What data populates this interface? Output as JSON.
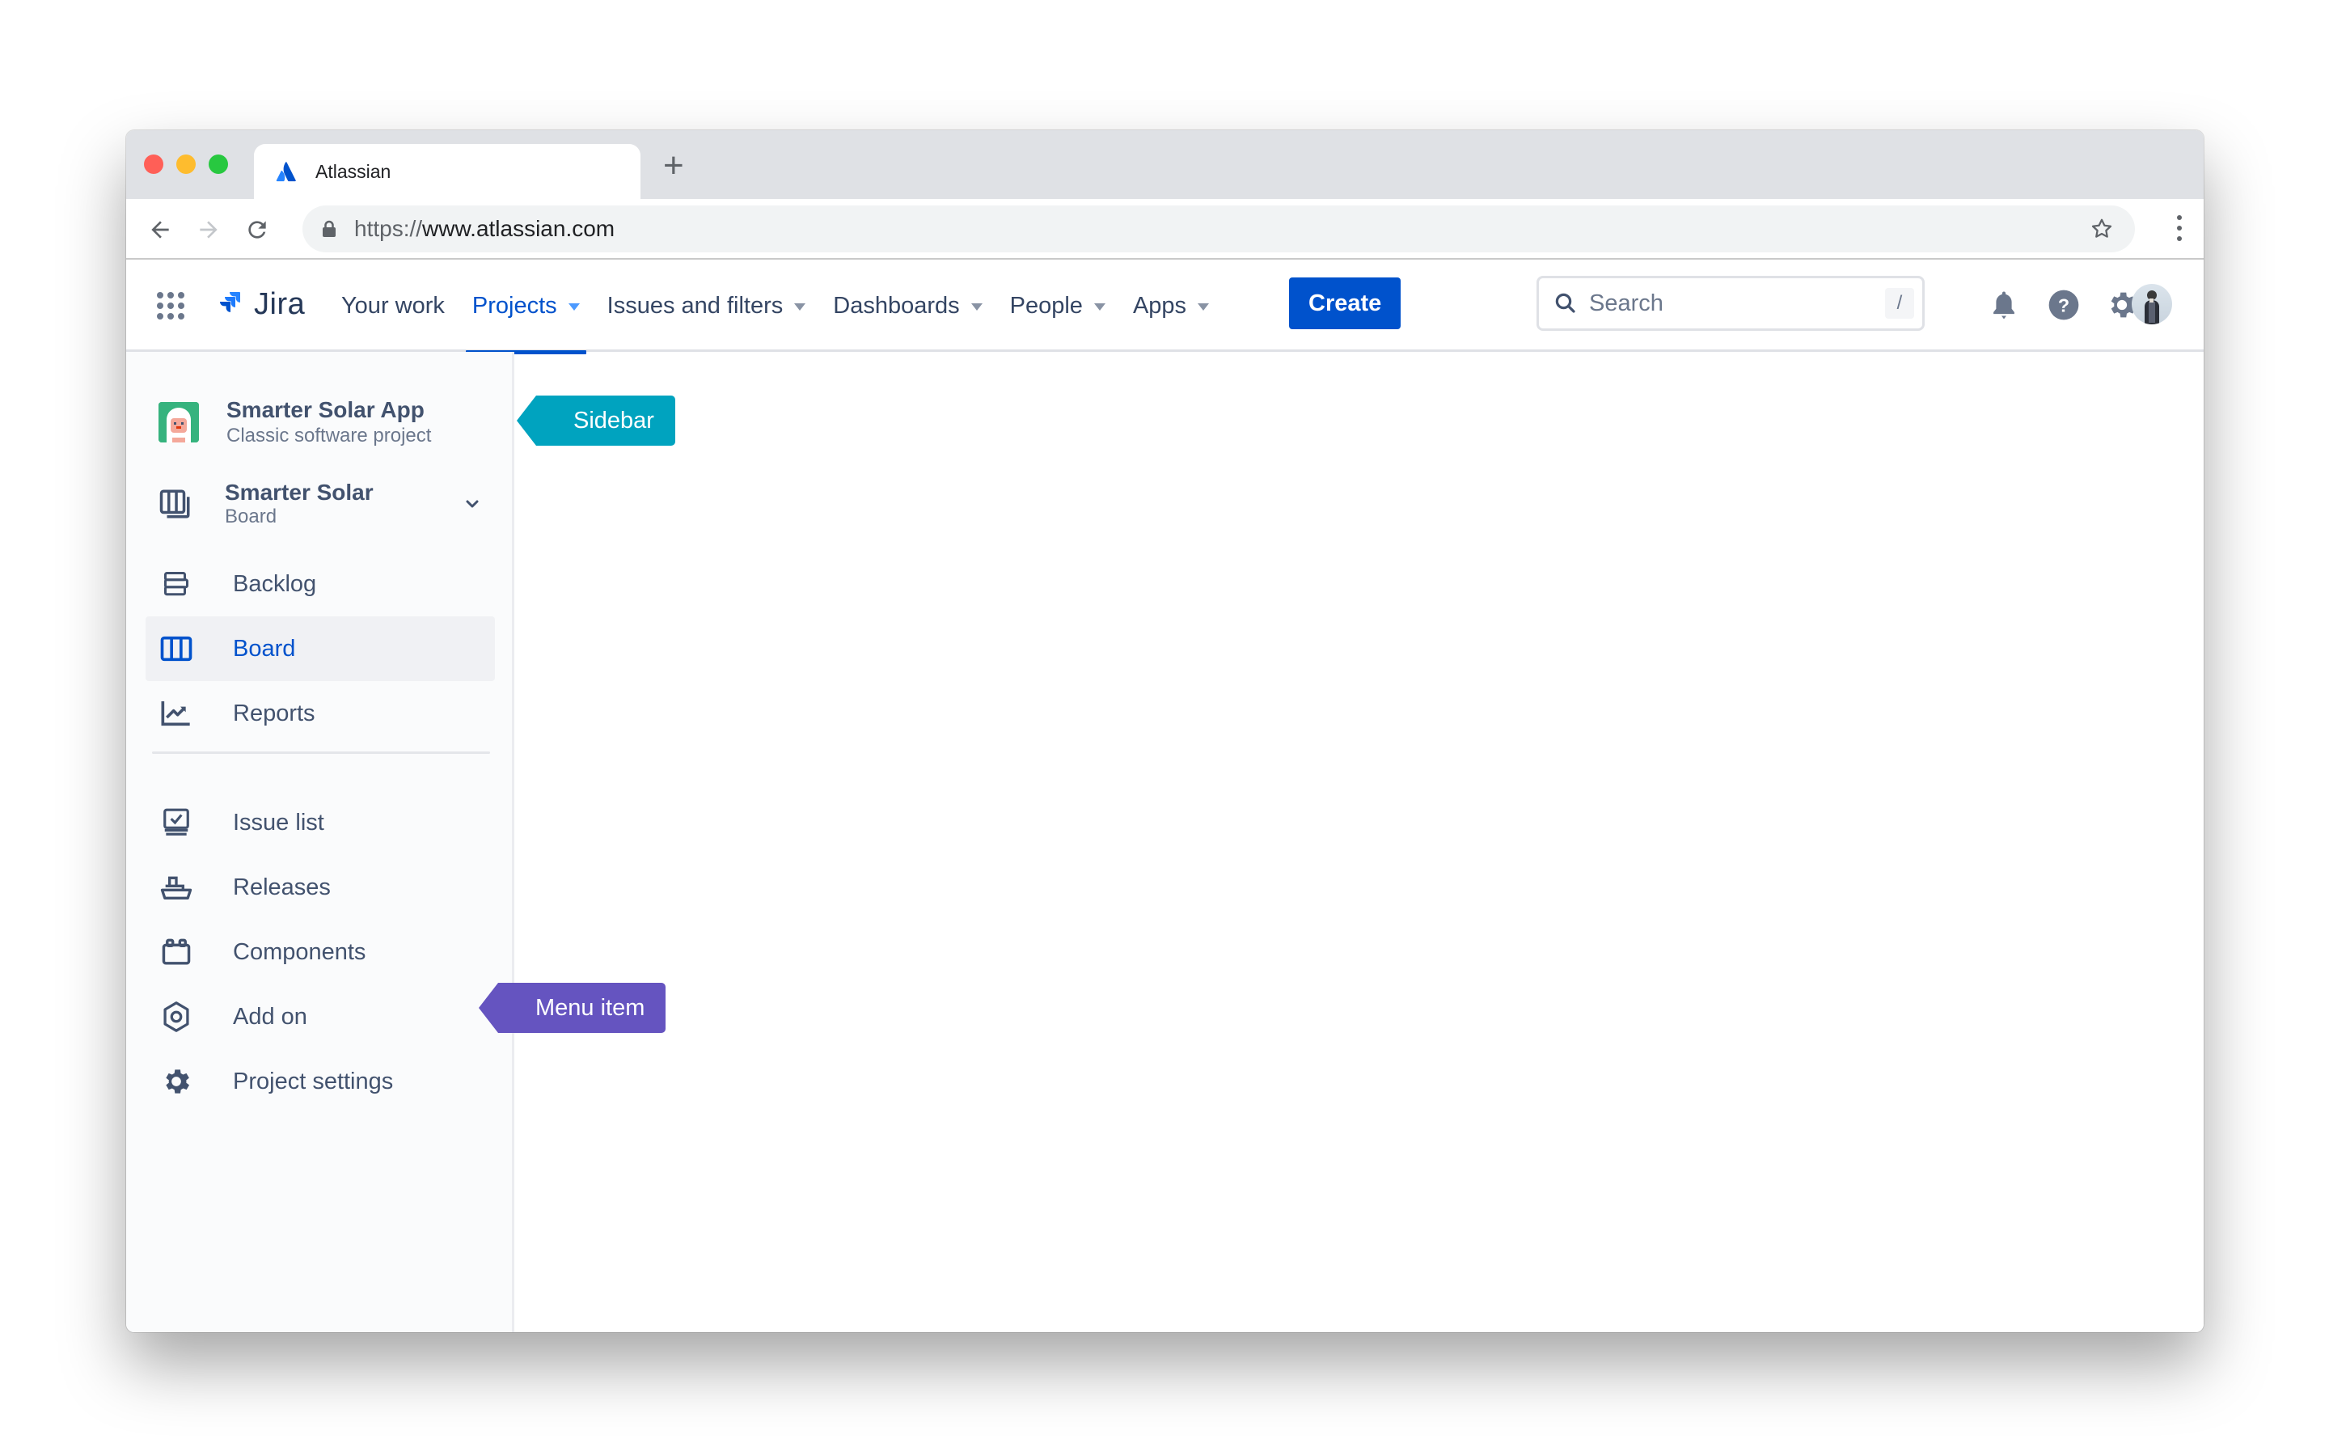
{
  "browser": {
    "tab_title": "Atlassian",
    "new_tab_label": "+",
    "url_scheme": "https://",
    "url_host": "www.atlassian.com",
    "icons": [
      "back-arrow-icon",
      "forward-arrow-icon",
      "reload-icon",
      "lock-icon",
      "bookmark-star-icon",
      "kebab-menu-icon"
    ]
  },
  "header": {
    "product": "Jira",
    "nav": [
      {
        "label": "Your work",
        "has_dropdown": false,
        "active": false
      },
      {
        "label": "Projects",
        "has_dropdown": true,
        "active": true
      },
      {
        "label": "Issues and filters",
        "has_dropdown": true,
        "active": false
      },
      {
        "label": "Dashboards",
        "has_dropdown": true,
        "active": false
      },
      {
        "label": "People",
        "has_dropdown": true,
        "active": false
      },
      {
        "label": "Apps",
        "has_dropdown": true,
        "active": false
      }
    ],
    "create_label": "Create",
    "search_placeholder": "Search",
    "search_shortcut": "/",
    "icons": [
      "app-switcher-icon",
      "notifications-bell-icon",
      "help-icon",
      "settings-gear-icon",
      "user-avatar"
    ]
  },
  "sidebar": {
    "project_name": "Smarter Solar App",
    "project_type": "Classic software project",
    "board_selector": {
      "title": "Smarter Solar",
      "subtitle": "Board"
    },
    "primary_items": [
      {
        "label": "Backlog",
        "icon": "backlog-icon",
        "selected": false
      },
      {
        "label": "Board",
        "icon": "board-icon",
        "selected": true
      },
      {
        "label": "Reports",
        "icon": "reports-icon",
        "selected": false
      }
    ],
    "secondary_items": [
      {
        "label": "Issue list",
        "icon": "issue-list-icon"
      },
      {
        "label": "Releases",
        "icon": "releases-ship-icon"
      },
      {
        "label": "Components",
        "icon": "components-icon"
      },
      {
        "label": "Add on",
        "icon": "add-on-hexagon-icon"
      },
      {
        "label": "Project settings",
        "icon": "project-settings-gear-icon"
      }
    ]
  },
  "annotations": {
    "sidebar_tag": "Sidebar",
    "menu_item_tag": "Menu item"
  },
  "colors": {
    "brand_blue": "#0052cc",
    "sidebar_tag": "#00a3bf",
    "menu_item_tag": "#6554c0",
    "text_primary": "#42526e"
  }
}
